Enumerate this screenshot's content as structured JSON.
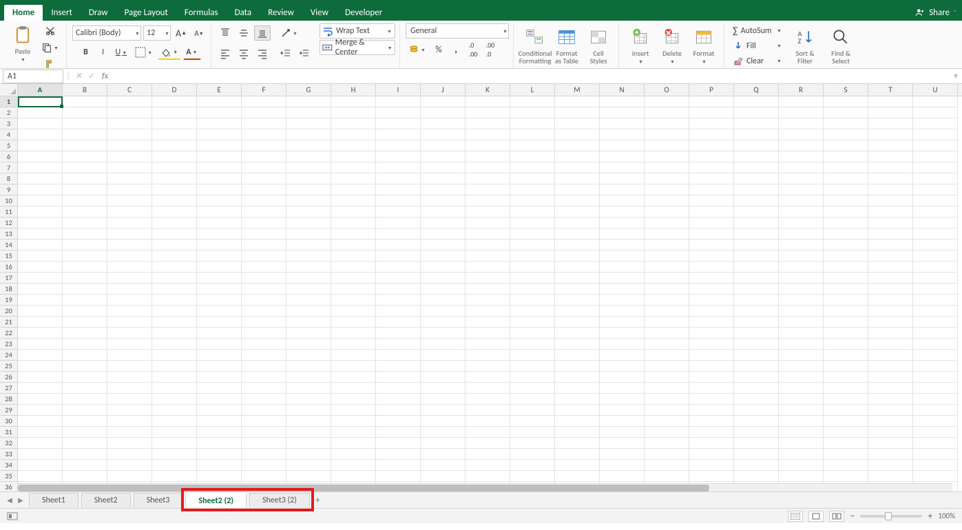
{
  "menu": {
    "tabs": [
      "Home",
      "Insert",
      "Draw",
      "Page Layout",
      "Formulas",
      "Data",
      "Review",
      "View",
      "Developer"
    ],
    "active": 0,
    "share": "Share"
  },
  "clipboard": {
    "paste": "Paste"
  },
  "font": {
    "name": "Calibri (Body)",
    "size": "12",
    "bold": "B",
    "italic": "I",
    "underline": "U"
  },
  "align": {
    "wrap": "Wrap Text",
    "merge": "Merge & Center"
  },
  "number": {
    "format": "General"
  },
  "styles": {
    "cond": "Conditional\nFormatting",
    "fat": "Format\nas Table",
    "cell": "Cell\nStyles"
  },
  "cells": {
    "insert": "Insert",
    "delete": "Delete",
    "format": "Format"
  },
  "editing": {
    "autosum": "AutoSum",
    "fill": "Fill",
    "clear": "Clear",
    "sort": "Sort &\nFilter",
    "find": "Find &\nSelect"
  },
  "fbar": {
    "name": "A1",
    "fx": "fx"
  },
  "columns": [
    "A",
    "B",
    "C",
    "D",
    "E",
    "F",
    "G",
    "H",
    "I",
    "J",
    "K",
    "L",
    "M",
    "N",
    "O",
    "P",
    "Q",
    "R",
    "S",
    "T",
    "U"
  ],
  "rows": 36,
  "sheets": {
    "list": [
      "Sheet1",
      "Sheet2",
      "Sheet3",
      "Sheet2 (2)",
      "Sheet3 (2)"
    ],
    "active": 3
  },
  "status": {
    "zoom": "100%"
  }
}
